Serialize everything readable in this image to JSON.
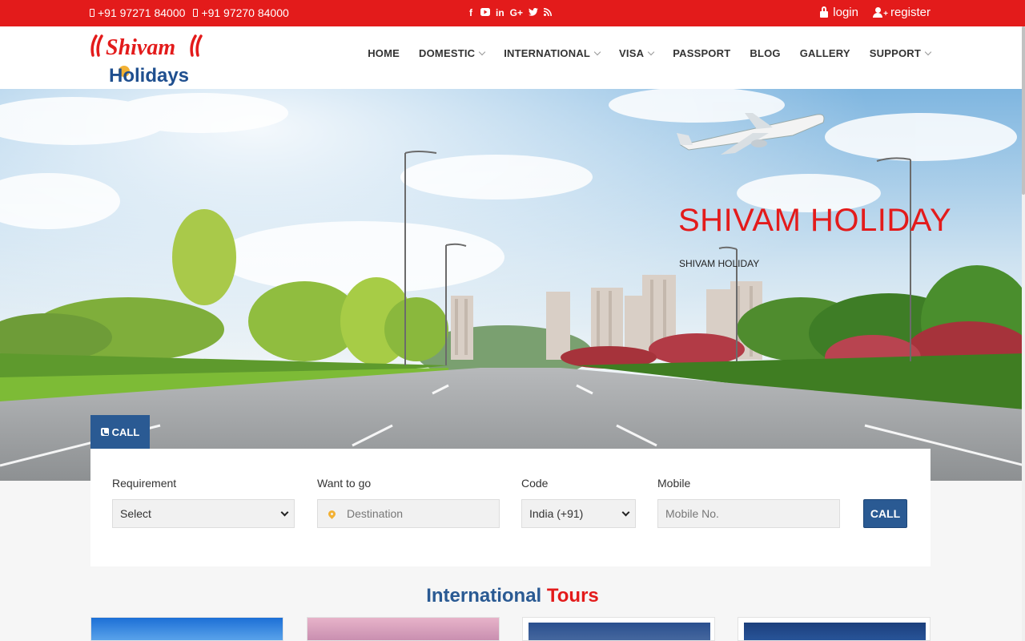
{
  "topbar": {
    "phones": [
      "+91 97271 84000",
      "+91 97270 84000"
    ],
    "socials": [
      "facebook-icon",
      "youtube-icon",
      "linkedin-icon",
      "google-plus-icon",
      "twitter-icon",
      "rss-icon"
    ],
    "social_glyphs": [
      "f",
      "▶",
      "in",
      "G+",
      "🐦",
      "≋"
    ],
    "login_label": "login",
    "register_label": "register",
    "color": "#e31b1b"
  },
  "header": {
    "logo_line1": "Shivam",
    "logo_line2": "Holidays",
    "nav": [
      {
        "label": "HOME",
        "dropdown": false
      },
      {
        "label": "DOMESTIC",
        "dropdown": true
      },
      {
        "label": "INTERNATIONAL",
        "dropdown": true
      },
      {
        "label": "VISA",
        "dropdown": true
      },
      {
        "label": "PASSPORT",
        "dropdown": false
      },
      {
        "label": "BLOG",
        "dropdown": false
      },
      {
        "label": "GALLERY",
        "dropdown": false
      },
      {
        "label": "SUPPORT",
        "dropdown": true
      }
    ]
  },
  "hero": {
    "title": "SHIVAM HOLIDAY",
    "subtitle": "SHIVAM HOLIDAY"
  },
  "enquiry": {
    "tab_label": "CALL",
    "requirement_label": "Requirement",
    "requirement_value": "Select",
    "destination_label": "Want to go",
    "destination_placeholder": "Destination",
    "code_label": "Code",
    "code_value": "India (+91)",
    "mobile_label": "Mobile",
    "mobile_placeholder": "Mobile No.",
    "submit_label": "CALL",
    "accent": "#2a5a93"
  },
  "section": {
    "title_part1": "International",
    "title_part2": "Tours"
  }
}
